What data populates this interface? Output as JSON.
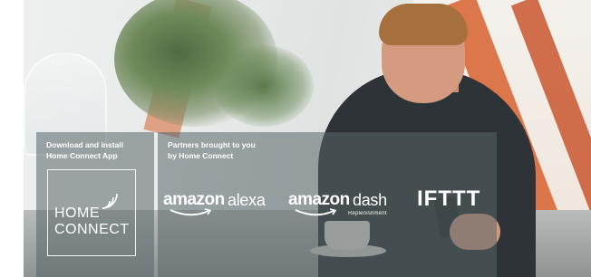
{
  "left_panel": {
    "line1": "Download and install",
    "line2": "Home Connect App",
    "logo_line1": "HOME",
    "logo_line2": "CONNECT"
  },
  "right_panel": {
    "line1": "Partners brought to you",
    "line2": "by Home Connect",
    "alexa": {
      "brand": "amazon",
      "product": "alexa"
    },
    "dash": {
      "brand": "amazon",
      "product": "dash",
      "sub": "Replenishment"
    },
    "ifttt": "IFTTT"
  },
  "colors": {
    "panel": "#58646a",
    "text": "#ffffff",
    "accent_orange": "#d9693a"
  }
}
